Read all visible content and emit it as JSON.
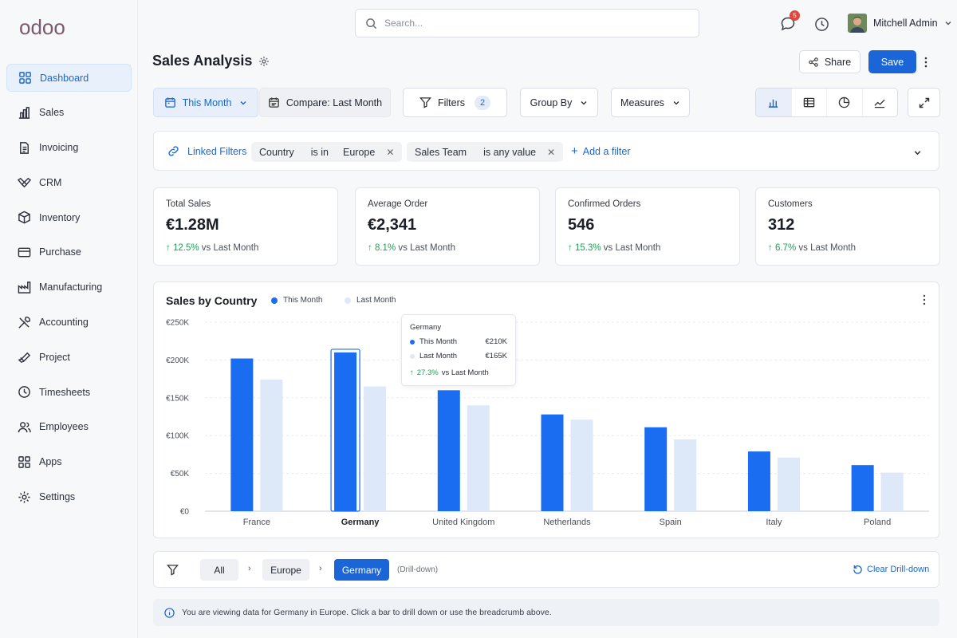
{
  "brand": {
    "logo_text": "odoo"
  },
  "sidebar": {
    "items": [
      {
        "label": "Dashboard",
        "icon": "grid-icon",
        "active": true
      },
      {
        "label": "Sales",
        "icon": "bar-chart-icon"
      },
      {
        "label": "Invoicing",
        "icon": "invoice-icon"
      },
      {
        "label": "CRM",
        "icon": "handshake-icon"
      },
      {
        "label": "Inventory",
        "icon": "box-icon"
      },
      {
        "label": "Purchase",
        "icon": "card-icon"
      },
      {
        "label": "Manufacturing",
        "icon": "factory-icon"
      },
      {
        "label": "Accounting",
        "icon": "tools-icon"
      },
      {
        "label": "Project",
        "icon": "check-icon"
      },
      {
        "label": "Timesheets",
        "icon": "clock-icon"
      },
      {
        "label": "Employees",
        "icon": "users-icon"
      },
      {
        "label": "Apps",
        "icon": "apps-icon"
      },
      {
        "label": "Settings",
        "icon": "gear-icon"
      }
    ]
  },
  "header": {
    "search_placeholder": "Search...",
    "notification_count": "5",
    "user_name": "Mitchell Admin"
  },
  "page": {
    "title": "Sales Analysis",
    "share_label": "Share",
    "save_label": "Save"
  },
  "toolbar": {
    "period_label": "This Month",
    "compare_label": "Compare: Last Month",
    "filters_label": "Filters",
    "filters_count": "2",
    "groupby_label": "Group By",
    "measures_label": "Measures"
  },
  "filterbar": {
    "linked_label": "Linked Filters",
    "chips": [
      {
        "field": "Country",
        "op": "is in",
        "value": "Europe"
      },
      {
        "field": "Sales Team",
        "op": "is any value",
        "value": ""
      }
    ],
    "add_label": "Add a filter"
  },
  "kpis": [
    {
      "label": "Total Sales",
      "value": "€1.28M",
      "delta": "12.5%",
      "suffix": "vs Last Month"
    },
    {
      "label": "Average Order",
      "value": "€2,341",
      "delta": "8.1%",
      "suffix": "vs Last Month"
    },
    {
      "label": "Confirmed Orders",
      "value": "546",
      "delta": "15.3%",
      "suffix": "vs Last Month"
    },
    {
      "label": "Customers",
      "value": "312",
      "delta": "6.7%",
      "suffix": "vs Last Month"
    }
  ],
  "chart_data": {
    "type": "bar",
    "title": "Sales by Country",
    "categories": [
      "France",
      "Germany",
      "United Kingdom",
      "Netherlands",
      "Spain",
      "Italy",
      "Poland"
    ],
    "series": [
      {
        "name": "This Month",
        "color": "#1a6df0",
        "values": [
          202,
          210,
          160,
          128,
          111,
          79,
          61
        ]
      },
      {
        "name": "Last Month",
        "color": "#dde8f8",
        "values": [
          174,
          165,
          140,
          121,
          95,
          71,
          51
        ]
      }
    ],
    "ylim": [
      0,
      250
    ],
    "yticks": [
      "€0",
      "€50K",
      "€100K",
      "€150K",
      "€200K",
      "€250K"
    ],
    "highlighted": "Germany",
    "grid": true,
    "legend": "top-left"
  },
  "tooltip": {
    "title": "Germany",
    "this_label": "This Month",
    "this_value": "€210K",
    "last_label": "Last Month",
    "last_value": "€165K",
    "delta": "27.3%",
    "suffix": "vs Last Month"
  },
  "breadcrumb": {
    "items": [
      "All",
      "Europe",
      "Germany"
    ],
    "note": "(Drill-down)",
    "clear_label": "Clear Drill-down"
  },
  "info": {
    "text": "You are viewing data for Germany in Europe. Click a bar to drill down or use the breadcrumb above."
  }
}
